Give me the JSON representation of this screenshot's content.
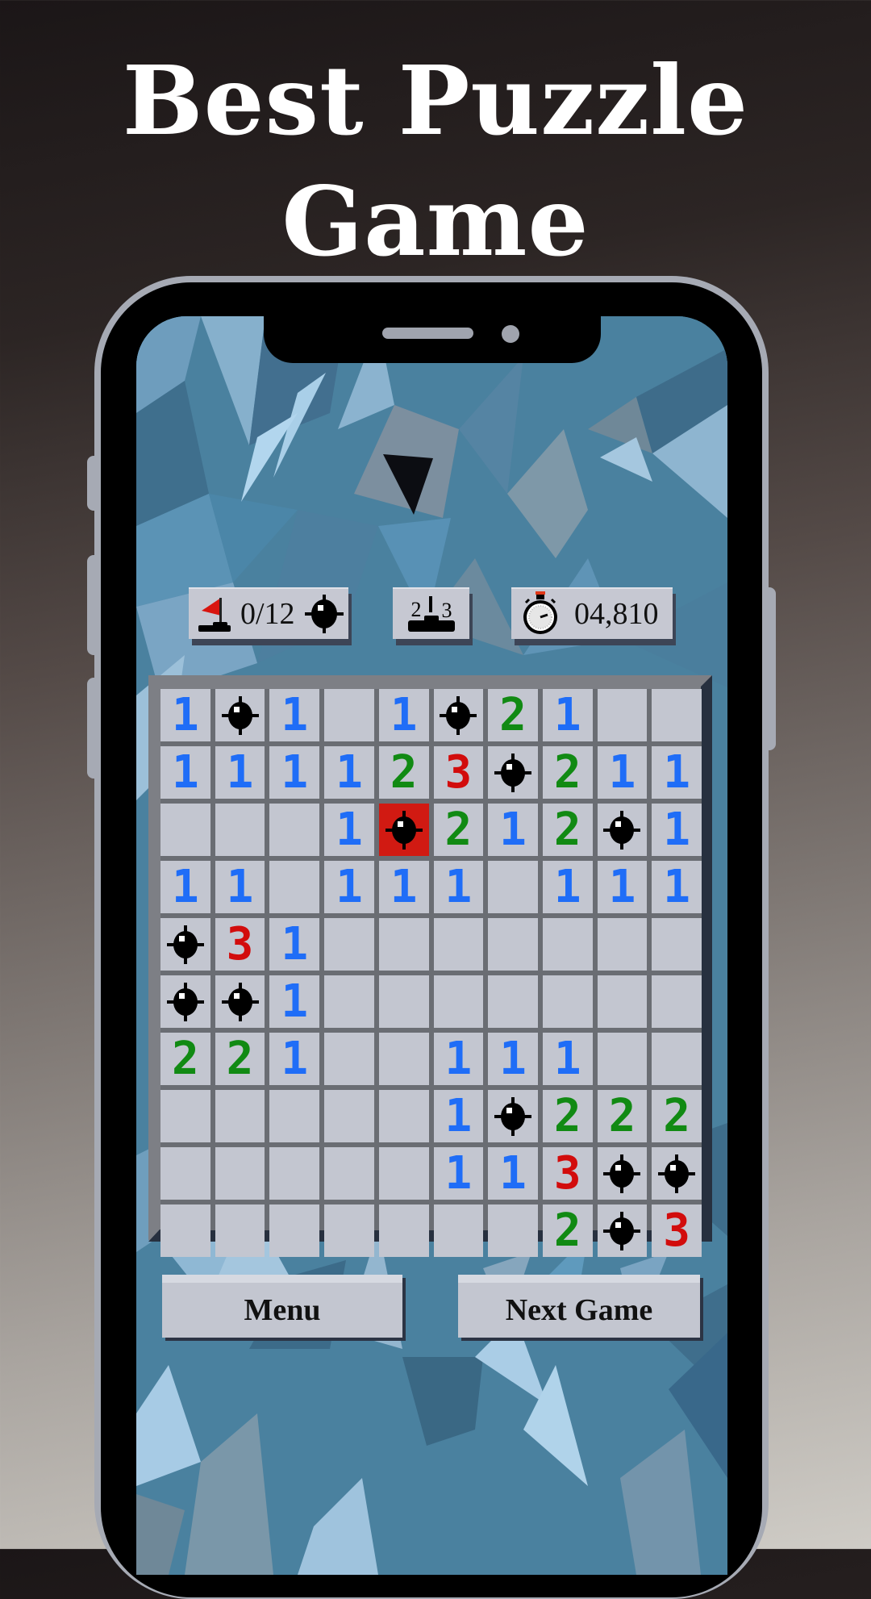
{
  "promo": {
    "title_line1": "Best Puzzle",
    "title_line2": "Game"
  },
  "hud": {
    "flags_text": "0/12",
    "flags_used": 0,
    "mine_total": 12,
    "rank_left": "2",
    "rank_right": "3",
    "timer_text": "04,810",
    "icons": {
      "flag": "flag-icon",
      "mine": "mine-icon",
      "rank": "podium-icon",
      "timer": "stopwatch-icon"
    }
  },
  "board": {
    "rows": 10,
    "cols": 10,
    "cells": [
      [
        "1",
        "M",
        "1",
        "",
        "1",
        "M",
        "2",
        "1",
        "",
        ""
      ],
      [
        "1",
        "1",
        "1",
        "1",
        "2",
        "3",
        "M",
        "2",
        "1",
        "1"
      ],
      [
        "",
        "",
        "",
        "1",
        "X",
        "2",
        "1",
        "2",
        "M",
        "1"
      ],
      [
        "1",
        "1",
        "",
        "1",
        "1",
        "1",
        "",
        "1",
        "1",
        "1"
      ],
      [
        "M",
        "3",
        "1",
        "",
        "",
        "",
        "",
        "",
        "",
        ""
      ],
      [
        "M",
        "M",
        "1",
        "",
        "",
        "",
        "",
        "",
        "",
        ""
      ],
      [
        "2",
        "2",
        "1",
        "",
        "",
        "1",
        "1",
        "1",
        "",
        ""
      ],
      [
        "",
        "",
        "",
        "",
        "",
        "1",
        "M",
        "2",
        "2",
        "2"
      ],
      [
        "",
        "",
        "",
        "",
        "",
        "1",
        "1",
        "3",
        "M",
        "M"
      ],
      [
        "",
        "",
        "",
        "",
        "",
        "",
        "",
        "2",
        "M",
        "3"
      ]
    ],
    "legend": {
      "M": "mine",
      "X": "exploded-mine",
      "": "empty-revealed"
    },
    "colors": {
      "1": "#1f6df7",
      "2": "#118a13",
      "3": "#d20c0c",
      "exploded": "#d11a12",
      "cell": "#c3c6d0"
    }
  },
  "buttons": {
    "menu": "Menu",
    "next_game": "Next Game"
  }
}
